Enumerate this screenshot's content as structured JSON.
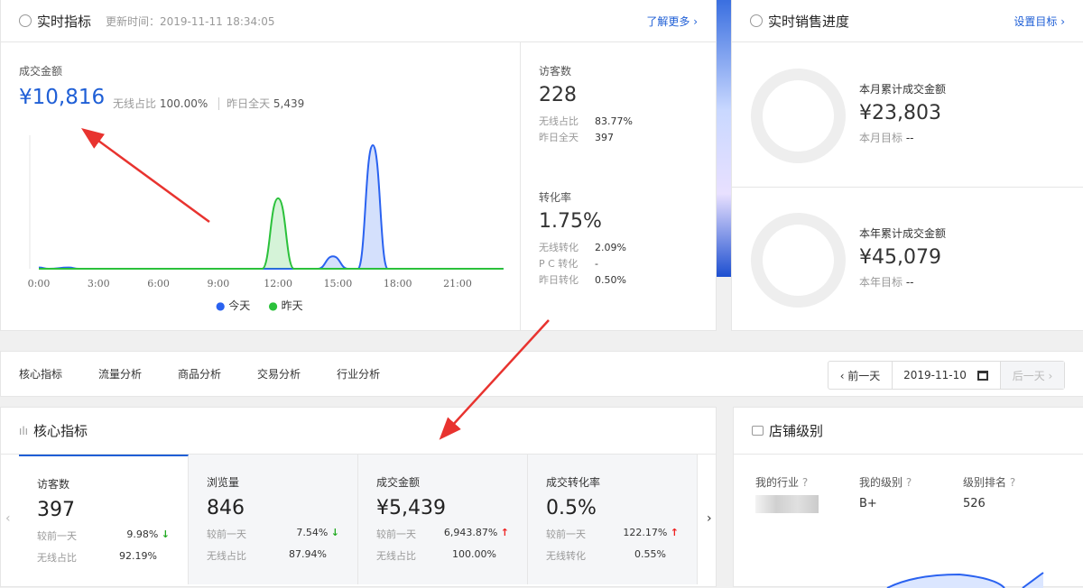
{
  "realtime": {
    "title": "实时指标",
    "update_time": "更新时间：2019-11-11 18:34:05",
    "more": "了解更多 ›",
    "gmv_label": "成交金额",
    "gmv_value": "¥10,816",
    "wireless_label": "无线占比",
    "wireless_value": "100.00%",
    "yday_label": "昨日全天",
    "yday_value": "5,439",
    "visitors": {
      "label": "访客数",
      "value": "228",
      "rows": [
        {
          "k": "无线占比",
          "v": "83.77%"
        },
        {
          "k": "昨日全天",
          "v": "397"
        }
      ]
    },
    "conversion": {
      "label": "转化率",
      "value": "1.75%",
      "rows": [
        {
          "k": "无线转化",
          "v": "2.09%"
        },
        {
          "k": "P C 转化",
          "v": "-"
        },
        {
          "k": "昨日转化",
          "v": "0.50%"
        }
      ]
    }
  },
  "chart_data": {
    "type": "area",
    "x_ticks": [
      "0:00",
      "3:00",
      "6:00",
      "9:00",
      "12:00",
      "15:00",
      "18:00",
      "21:00"
    ],
    "xlim": [
      0,
      23
    ],
    "ylim": [
      0,
      100
    ],
    "legend": [
      "今天",
      "昨天"
    ],
    "legend_position": "bottom",
    "series": [
      {
        "name": "今天",
        "color": "#2a62f0",
        "points": [
          [
            0,
            1
          ],
          [
            0.5,
            0
          ],
          [
            1.5,
            1
          ],
          [
            2,
            0
          ],
          [
            14,
            0
          ],
          [
            14.75,
            10
          ],
          [
            15.5,
            0
          ],
          [
            16,
            0
          ],
          [
            16.75,
            100
          ],
          [
            17.5,
            0
          ],
          [
            23.3,
            0
          ]
        ]
      },
      {
        "name": "昨天",
        "color": "#2bc13b",
        "points": [
          [
            0,
            0
          ],
          [
            11.2,
            0
          ],
          [
            12,
            57
          ],
          [
            12.8,
            0
          ],
          [
            23.3,
            0
          ]
        ]
      }
    ]
  },
  "sales": {
    "title": "实时销售进度",
    "link": "设置目标 ›",
    "month": {
      "label": "本月累计成交金额",
      "value": "¥23,803",
      "target_label": "本月目标",
      "target": "--"
    },
    "year": {
      "label": "本年累计成交金额",
      "value": "¥45,079",
      "target_label": "本年目标",
      "target": "--"
    }
  },
  "tabs": [
    "核心指标",
    "流量分析",
    "商品分析",
    "交易分析",
    "行业分析"
  ],
  "date": {
    "prev": "‹ 前一天",
    "value": "2019-11-10",
    "next": "后一天 ›"
  },
  "core": {
    "title": "核心指标",
    "items": [
      {
        "t": "访客数",
        "v": "397",
        "k1": "较前一天",
        "v1": "9.98%",
        "dir": "down",
        "k2": "无线占比",
        "v2": "92.19%"
      },
      {
        "t": "浏览量",
        "v": "846",
        "k1": "较前一天",
        "v1": "7.54%",
        "dir": "down",
        "k2": "无线占比",
        "v2": "87.94%"
      },
      {
        "t": "成交金额",
        "v": "¥5,439",
        "k1": "较前一天",
        "v1": "6,943.87%",
        "dir": "up",
        "k2": "无线占比",
        "v2": "100.00%"
      },
      {
        "t": "成交转化率",
        "v": "0.5%",
        "k1": "较前一天",
        "v1": "122.17%",
        "dir": "up",
        "k2": "无线转化",
        "v2": "0.55%"
      }
    ]
  },
  "shop": {
    "title": "店铺级别",
    "cols": [
      {
        "k": "我的行业",
        "v": ""
      },
      {
        "k": "我的级别",
        "v": "B+"
      },
      {
        "k": "级别排名",
        "v": "526"
      }
    ]
  },
  "arrows": {
    "down": "↓",
    "up": "↑",
    "qmark": "?"
  }
}
